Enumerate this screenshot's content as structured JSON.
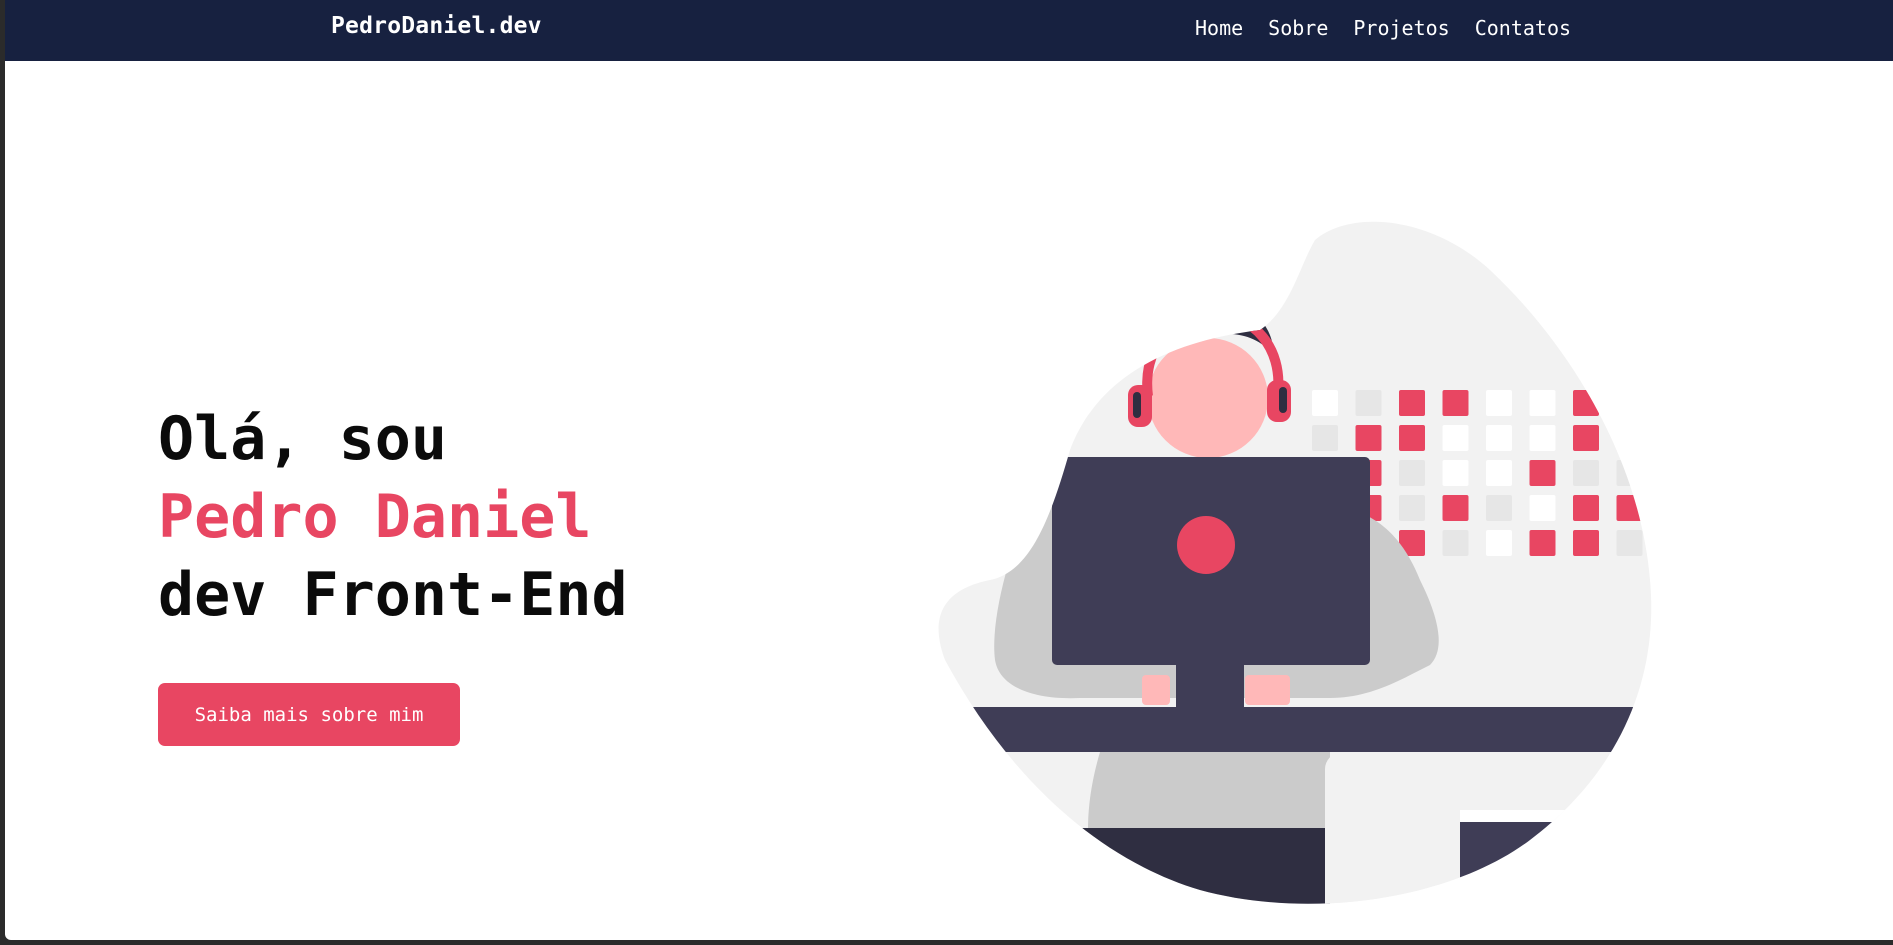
{
  "header": {
    "brand": "PedroDaniel.dev",
    "nav": [
      {
        "label": "Home"
      },
      {
        "label": "Sobre"
      },
      {
        "label": "Projetos"
      },
      {
        "label": "Contatos"
      }
    ]
  },
  "hero": {
    "line1": "Olá, sou",
    "line2": "Pedro Daniel",
    "line3": "dev Front-End",
    "cta_label": "Saiba mais sobre mim"
  },
  "illustration": {
    "name": "developer-at-computer-illustration"
  },
  "colors": {
    "navbar": "#172140",
    "accent": "#e84662",
    "dark": "#3f3d56",
    "blob": "#f2f2f2"
  }
}
